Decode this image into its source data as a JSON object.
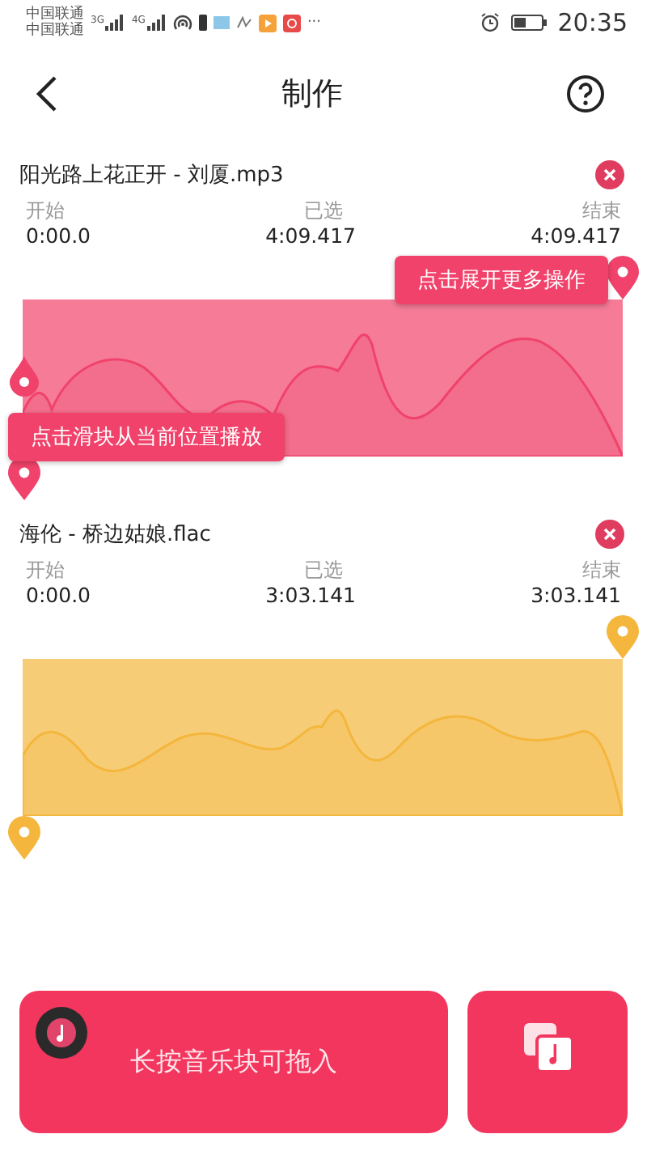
{
  "status_bar": {
    "carriers": [
      "中国联通",
      "中国联通"
    ],
    "network_labels": [
      "3G",
      "4G"
    ],
    "more": "···",
    "time": "20:35"
  },
  "header": {
    "title": "制作"
  },
  "tracks": [
    {
      "name": "阳光路上花正开 - 刘厦.mp3",
      "start_label": "开始",
      "start": "0:00.0",
      "selected_label": "已选",
      "selected": "4:09.417",
      "end_label": "结束",
      "end": "4:09.417",
      "color": "#f0426a",
      "hints": [
        {
          "kind": "end",
          "text": "点击展开更多操作"
        },
        {
          "kind": "start",
          "text": "点击滑块从当前位置播放"
        }
      ]
    },
    {
      "name": "海伦 - 桥边姑娘.flac",
      "start_label": "开始",
      "start": "0:00.0",
      "selected_label": "已选",
      "selected": "3:03.141",
      "end_label": "结束",
      "end": "3:03.141",
      "color": "#f4b63c"
    }
  ],
  "drop_area": {
    "text": "长按音乐块可拖入"
  }
}
